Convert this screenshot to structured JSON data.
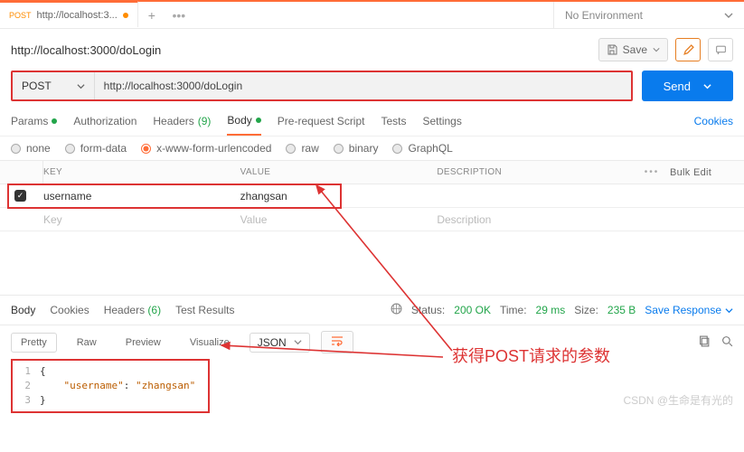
{
  "tab": {
    "method": "POST",
    "title": "http://localhost:3...",
    "env": "No Environment"
  },
  "request": {
    "title": "http://localhost:3000/doLogin",
    "save": "Save",
    "method": "POST",
    "url": "http://localhost:3000/doLogin",
    "send": "Send"
  },
  "reqTabs": {
    "params": "Params",
    "auth": "Authorization",
    "headers": "Headers",
    "headersCount": "(9)",
    "body": "Body",
    "prereq": "Pre-request Script",
    "tests": "Tests",
    "settings": "Settings",
    "cookies": "Cookies"
  },
  "bodyTypes": {
    "none": "none",
    "form": "form-data",
    "xform": "x-www-form-urlencoded",
    "raw": "raw",
    "binary": "binary",
    "graphql": "GraphQL"
  },
  "kv": {
    "headKey": "KEY",
    "headVal": "VALUE",
    "headDesc": "DESCRIPTION",
    "bulk": "Bulk Edit",
    "dots": "•••",
    "rows": [
      {
        "key": "username",
        "value": "zhangsan",
        "desc": ""
      }
    ],
    "ph": {
      "key": "Key",
      "value": "Value",
      "desc": "Description"
    }
  },
  "respTabs": {
    "body": "Body",
    "cookies": "Cookies",
    "headers": "Headers",
    "headersCount": "(6)",
    "testResults": "Test Results"
  },
  "status": {
    "label": "Status:",
    "code": "200 OK",
    "timeLabel": "Time:",
    "time": "29 ms",
    "sizeLabel": "Size:",
    "size": "235 B",
    "save": "Save Response"
  },
  "view": {
    "pretty": "Pretty",
    "raw": "Raw",
    "preview": "Preview",
    "visualize": "Visualize",
    "json": "JSON"
  },
  "response": {
    "l1": "{",
    "l2a": "\"username\"",
    "l2b": ": ",
    "l2c": "\"zhangsan\"",
    "l3": "}"
  },
  "annotation": "获得POST请求的参数",
  "watermark": "CSDN @生命是有光的"
}
